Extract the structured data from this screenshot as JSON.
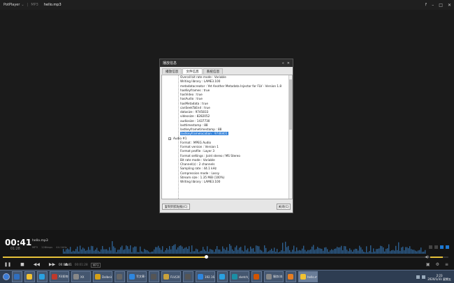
{
  "titlebar": {
    "app_name": "PotPlayer",
    "format": "MP3",
    "file_name": "hello.mp3"
  },
  "dialog": {
    "title": "播放信息",
    "tabs": [
      "播放信息",
      "文件信息",
      "系统信息"
    ],
    "active_tab": 1,
    "tree": [
      {
        "level": 2,
        "text": "Overall bit rate mode : Variable"
      },
      {
        "level": 2,
        "text": "Writing library : LAME3.100"
      },
      {
        "level": 2,
        "text": "metadatacreator : Yet Another Metadata Injector for FLV - Version 1.8"
      },
      {
        "level": 2,
        "text": "hasKeyframes : true"
      },
      {
        "level": 2,
        "text": "hasVideo : true"
      },
      {
        "level": 2,
        "text": "hasAudio : true"
      },
      {
        "level": 2,
        "text": "hasMetadata : true"
      },
      {
        "level": 2,
        "text": "canSeekToEnd : true"
      },
      {
        "level": 2,
        "text": "datasize : 9745833"
      },
      {
        "level": 2,
        "text": "videosize : 8282052"
      },
      {
        "level": 2,
        "text": "audiosize : 1437730"
      },
      {
        "level": 2,
        "text": "lasttimestamp : 88"
      },
      {
        "level": 2,
        "text": "lastkeyframetimestamp : 88"
      },
      {
        "level": 2,
        "text": "lastkeyframelocation : 9746401",
        "selected": true
      },
      {
        "level": 1,
        "text": "Audio #1",
        "expander": "−"
      },
      {
        "level": 2,
        "text": "Format : MPEG Audio"
      },
      {
        "level": 2,
        "text": "Format version : Version 1"
      },
      {
        "level": 2,
        "text": "Format profile : Layer 3"
      },
      {
        "level": 2,
        "text": "Format settings : Joint stereo / MS Stereo"
      },
      {
        "level": 2,
        "text": "Bit rate mode : Variable"
      },
      {
        "level": 2,
        "text": "Channel(s) : 2 channels"
      },
      {
        "level": 2,
        "text": "Sampling rate : 44.1 kHz"
      },
      {
        "level": 2,
        "text": "Compression mode : Lossy"
      },
      {
        "level": 2,
        "text": "Stream size : 1.35 MiB (100%)"
      },
      {
        "level": 2,
        "text": "Writing library : LAME3.100"
      }
    ],
    "copy_button": "复制到剪贴板(C)",
    "close_button": "关闭(C)"
  },
  "player": {
    "current_time": "00:41",
    "total_time": "01:28",
    "track_title": "hello.mp3",
    "meta": [
      "MP3",
      "128kbps",
      "44.1kHz"
    ],
    "progress": 0.47,
    "volume": 0.7,
    "bottom_current": "00:00:41",
    "bottom_total": "00:01:28",
    "bottom_badge": "MP3"
  },
  "taskbar": {
    "apps": [
      {
        "label": "",
        "color": "#2f6fc0"
      },
      {
        "label": "",
        "color": "#f1c232"
      },
      {
        "label": "",
        "color": "#2aa1e0"
      },
      {
        "label": "Xi(如何给...",
        "color": "#c0392b"
      },
      {
        "label": "XX",
        "color": "#888"
      },
      {
        "label": "Dolbeinfo...",
        "color": "#d4a017"
      },
      {
        "label": "",
        "color": "#666"
      },
      {
        "label": "写文章 - 知...",
        "color": "#2e86de"
      },
      {
        "label": "",
        "color": "#555"
      },
      {
        "label": "FLV(2014...",
        "color": "#c9a23b"
      },
      {
        "label": "",
        "color": "#555"
      },
      {
        "label": "192.168.1...",
        "color": "#2e86de"
      },
      {
        "label": "",
        "color": "#2aa1e0"
      },
      {
        "label": "sketch_jan...",
        "color": "#1b8fa6"
      },
      {
        "label": "",
        "color": "#d35400"
      },
      {
        "label": "服务(本...",
        "color": "#888"
      },
      {
        "label": "",
        "color": "#e67e22"
      },
      {
        "label": "hello.mp3...",
        "color": "#f1c232"
      }
    ],
    "clock_time": "2:23",
    "clock_date": "2020/1/31 星期五"
  }
}
